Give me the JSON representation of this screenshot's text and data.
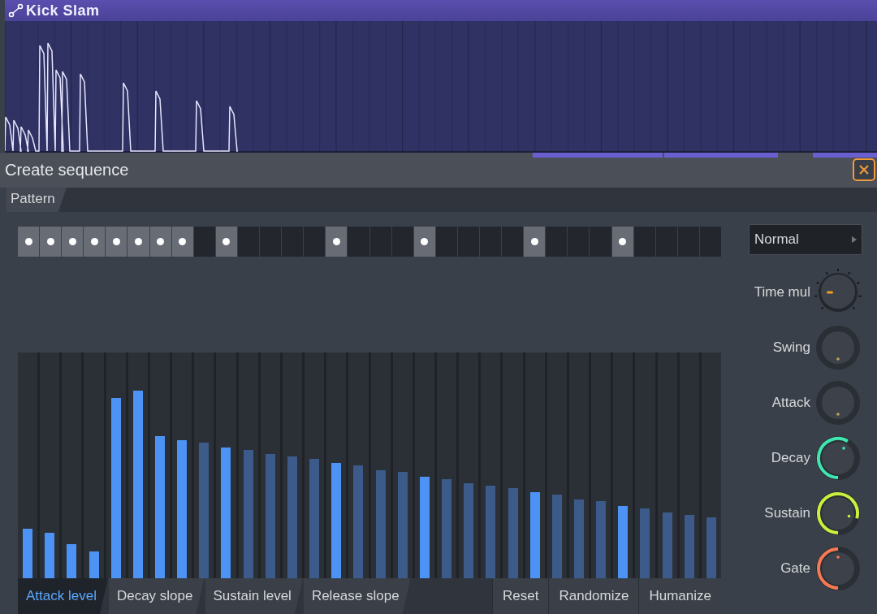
{
  "clip": {
    "title": "Kick Slam"
  },
  "dialog": {
    "title": "Create sequence",
    "tab": "Pattern"
  },
  "steps": [
    {
      "on": true
    },
    {
      "on": true
    },
    {
      "on": true
    },
    {
      "on": true
    },
    {
      "on": true
    },
    {
      "on": true
    },
    {
      "on": true
    },
    {
      "on": true
    },
    {
      "on": false
    },
    {
      "on": true
    },
    {
      "on": false
    },
    {
      "on": false
    },
    {
      "on": false
    },
    {
      "on": false
    },
    {
      "on": true
    },
    {
      "on": false
    },
    {
      "on": false
    },
    {
      "on": false
    },
    {
      "on": true
    },
    {
      "on": false
    },
    {
      "on": false
    },
    {
      "on": false
    },
    {
      "on": false
    },
    {
      "on": true
    },
    {
      "on": false
    },
    {
      "on": false
    },
    {
      "on": false
    },
    {
      "on": true
    },
    {
      "on": false
    },
    {
      "on": false
    },
    {
      "on": false
    },
    {
      "on": false
    }
  ],
  "bars": [
    {
      "level": 0.22
    },
    {
      "level": 0.2
    },
    {
      "level": 0.15
    },
    {
      "level": 0.12
    },
    {
      "level": 0.8
    },
    {
      "level": 0.83
    },
    {
      "level": 0.63
    },
    {
      "level": 0.61
    },
    {
      "level": 0.6
    },
    {
      "level": 0.58
    },
    {
      "level": 0.57
    },
    {
      "level": 0.55
    },
    {
      "level": 0.54
    },
    {
      "level": 0.53
    },
    {
      "level": 0.51
    },
    {
      "level": 0.5
    },
    {
      "level": 0.48
    },
    {
      "level": 0.47
    },
    {
      "level": 0.45
    },
    {
      "level": 0.44
    },
    {
      "level": 0.42
    },
    {
      "level": 0.41
    },
    {
      "level": 0.4
    },
    {
      "level": 0.38
    },
    {
      "level": 0.37
    },
    {
      "level": 0.35
    },
    {
      "level": 0.34
    },
    {
      "level": 0.32
    },
    {
      "level": 0.31
    },
    {
      "level": 0.29
    },
    {
      "level": 0.28
    },
    {
      "level": 0.27
    }
  ],
  "mode": {
    "value": "Normal"
  },
  "knobs": [
    {
      "label": "Time mul",
      "kind": "ticked",
      "level": 0.3
    },
    {
      "label": "Swing",
      "kind": "ring"
    },
    {
      "label": "Attack",
      "kind": "ring"
    },
    {
      "label": "Decay",
      "kind": "ring",
      "level": 0.7,
      "color": "#3ee6b0"
    },
    {
      "label": "Sustain",
      "kind": "ring",
      "level": 0.95,
      "color": "#c8f03c"
    },
    {
      "label": "Gate",
      "kind": "ring",
      "level": 0.6,
      "color": "#f57a52"
    }
  ],
  "edit_tabs": [
    {
      "label": "Attack level",
      "selected": true
    },
    {
      "label": "Decay slope",
      "selected": false
    },
    {
      "label": "Sustain level",
      "selected": false
    },
    {
      "label": "Release slope",
      "selected": false
    }
  ],
  "buttons": [
    "Reset",
    "Randomize",
    "Humanize"
  ]
}
